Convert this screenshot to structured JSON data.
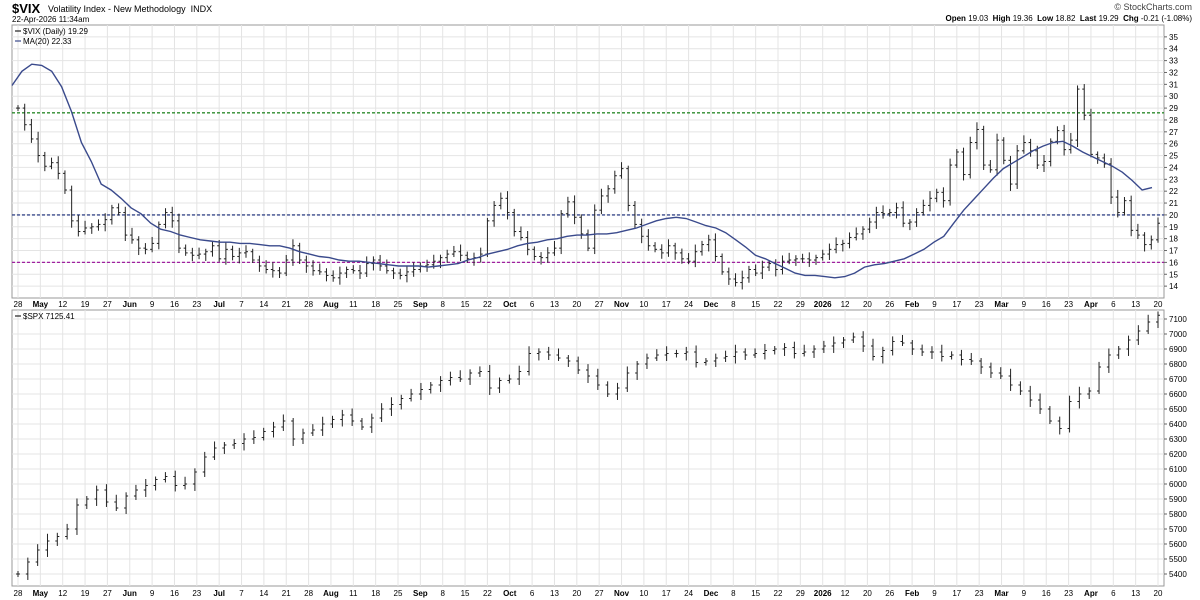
{
  "header": {
    "ticker": "$VIX",
    "name": "Volatility Index - New Methodology",
    "exchange": "INDX",
    "datetime": "22-Apr-2026 11:34am",
    "brand": "© StockCharts.com",
    "quote": {
      "open_label": "Open",
      "open": "19.03",
      "high_label": "High",
      "high": "19.36",
      "low_label": "Low",
      "low": "18.82",
      "last_label": "Last",
      "last": "19.29",
      "chg_label": "Chg",
      "chg": "-0.21 (-1.08%)"
    }
  },
  "colors": {
    "bars": "#222222",
    "ma": "#3a4a8c",
    "upper_line": "#2e8b2e",
    "mid_line": "#3a4a8c",
    "lower_line": "#a020a0",
    "grid": "#e4e4e4",
    "border": "#999999"
  },
  "chart_data": [
    {
      "type": "line",
      "subtype": "ohlc",
      "legend": [
        "$VIX (Daily) 19.29",
        "MA(20) 22.33"
      ],
      "series": [
        {
          "name": "$VIX (Daily)",
          "values": [
            29,
            27.6,
            26.4,
            25,
            24.1,
            24.4,
            23.5,
            22.1,
            19.5,
            18.6,
            18.9,
            19,
            19.2,
            19.6,
            20.6,
            20.2,
            18.3,
            17.9,
            17.2,
            17.1,
            17.6,
            19.2,
            20.2,
            19.5,
            17.2,
            16.8,
            16.6,
            16.7,
            16.9,
            17.4,
            16.3,
            17.1,
            16.5,
            16.8,
            16.9,
            16.2,
            15.7,
            15.4,
            15.3,
            15.1,
            16.2,
            17.4,
            16.2,
            15.7,
            15.3,
            15.2,
            14.9,
            14.7,
            15.1,
            15.4,
            15.3,
            15.1,
            15.9,
            16.2,
            15.7,
            15.3,
            15.1,
            14.9,
            15.2,
            15.4,
            15.7,
            15.8,
            16.1,
            16.4,
            16.7,
            16.9,
            16.6,
            16.3,
            16.4,
            16.7,
            19.5,
            20.8,
            21.4,
            20.2,
            18.6,
            18.1,
            17.1,
            16.5,
            16.4,
            16.8,
            17.2,
            20.1,
            21.1,
            19.8,
            18.4,
            17.2,
            20.4,
            21.6,
            22.2,
            23.3,
            23.9,
            20.8,
            19.2,
            18.2,
            17.4,
            17.1,
            16.8,
            17.4,
            16.8,
            16.3,
            16.1,
            16.9,
            17.5,
            17.9,
            16.5,
            15.2,
            14.6,
            14.3,
            14.7,
            15.4,
            15.1,
            15.6,
            15.9,
            15.4,
            16.1,
            16.2,
            16.3,
            16.3,
            16.2,
            16.4,
            16.7,
            17.1,
            17.5,
            17.6,
            18.1,
            18.4,
            18.8,
            19.4,
            20.2,
            20.1,
            20.2,
            20.6,
            19.3,
            19.4,
            20.2,
            20.8,
            21.4,
            21.9,
            21.2,
            24.2,
            25.3,
            23.4,
            26.1,
            27.2,
            24.2,
            23.8,
            26.3,
            24.6,
            22.6,
            25.4,
            26.1,
            25.4,
            24.2,
            24.5,
            26.2,
            27.1,
            25.5,
            26.3,
            30.6,
            28.4,
            25.1,
            24.8,
            24.3,
            21.5,
            20.2,
            21.2,
            18.7,
            18.3,
            17.5,
            17.9,
            19.3
          ]
        },
        {
          "name": "MA(20)",
          "values": [
            30.9,
            32.1,
            32.7,
            32.6,
            32.1,
            30.8,
            28.7,
            26.1,
            24.5,
            22.6,
            22.1,
            21.4,
            20.6,
            20.1,
            19.3,
            18.8,
            18.6,
            18.3,
            18.1,
            17.9,
            17.8,
            17.7,
            17.7,
            17.6,
            17.6,
            17.5,
            17.4,
            17.4,
            17.2,
            16.9,
            16.7,
            16.5,
            16.4,
            16.2,
            16.1,
            16.1,
            16,
            15.9,
            15.8,
            15.7,
            15.7,
            15.7,
            15.6,
            15.7,
            15.8,
            15.9,
            16.2,
            16.4,
            16.7,
            16.9,
            17.1,
            17.4,
            17.6,
            17.7,
            17.9,
            18,
            18.2,
            18.3,
            18.3,
            18.4,
            18.4,
            18.5,
            18.7,
            18.9,
            19.2,
            19.5,
            19.7,
            19.8,
            19.7,
            19.4,
            19.1,
            18.9,
            18.5,
            17.9,
            17.3,
            16.6,
            16.3,
            15.9,
            15.5,
            15.1,
            14.9,
            14.9,
            14.8,
            14.7,
            14.8,
            15.1,
            15.6,
            15.8,
            15.9,
            16.1,
            16.3,
            16.7,
            17.1,
            17.7,
            18.2,
            19.3,
            20.4,
            21.3,
            22.2,
            23.1,
            23.9,
            24.4,
            24.9,
            25.4,
            25.8,
            26.1,
            26.2,
            25.8,
            25.3,
            24.9,
            24.5,
            24.1,
            23.6,
            22.9,
            22.1,
            22.3
          ]
        }
      ],
      "y_ticks": [
        "14",
        "15",
        "16",
        "17",
        "18",
        "19",
        "20",
        "21",
        "22",
        "23",
        "24",
        "25",
        "26",
        "27",
        "28",
        "29",
        "30",
        "31",
        "32",
        "33",
        "34",
        "35"
      ],
      "ylim": [
        13,
        36
      ],
      "horizontal_lines": [
        {
          "value": 28.6,
          "color": "green",
          "style": "dashed"
        },
        {
          "value": 20,
          "color": "navy",
          "style": "dashed"
        },
        {
          "value": 16,
          "color": "purple",
          "style": "dashed"
        }
      ],
      "grid": true
    },
    {
      "type": "line",
      "subtype": "ohlc",
      "legend": [
        "$SPX 7125.41"
      ],
      "series": [
        {
          "name": "$SPX",
          "values": [
            5400,
            5480,
            5560,
            5620,
            5650,
            5700,
            5860,
            5900,
            5960,
            5880,
            5840,
            5920,
            5960,
            5990,
            6030,
            6050,
            5990,
            6000,
            6080,
            6180,
            6240,
            6260,
            6270,
            6300,
            6310,
            6350,
            6380,
            6420,
            6300,
            6340,
            6360,
            6400,
            6430,
            6460,
            6420,
            6380,
            6440,
            6500,
            6530,
            6570,
            6600,
            6630,
            6660,
            6690,
            6710,
            6700,
            6740,
            6750,
            6640,
            6690,
            6700,
            6750,
            6870,
            6880,
            6860,
            6840,
            6820,
            6760,
            6720,
            6660,
            6600,
            6640,
            6740,
            6800,
            6840,
            6860,
            6870,
            6870,
            6880,
            6810,
            6820,
            6840,
            6850,
            6880,
            6860,
            6870,
            6890,
            6900,
            6910,
            6870,
            6880,
            6900,
            6920,
            6940,
            6960,
            6980,
            6920,
            6850,
            6890,
            6950,
            6940,
            6900,
            6880,
            6880,
            6850,
            6860,
            6830,
            6820,
            6780,
            6740,
            6720,
            6660,
            6620,
            6560,
            6500,
            6420,
            6370,
            6550,
            6600,
            6620,
            6780,
            6860,
            6900,
            6960,
            7020,
            7080,
            7125
          ]
        }
      ],
      "y_ticks": [
        "5400",
        "5500",
        "5600",
        "5700",
        "5800",
        "5900",
        "6000",
        "6100",
        "6200",
        "6300",
        "6400",
        "6500",
        "6600",
        "6700",
        "6800",
        "6900",
        "7000",
        "7100"
      ],
      "ylim": [
        5320,
        7160
      ],
      "grid": true
    }
  ],
  "x_axis": {
    "ticks_top": [
      "28",
      "May",
      "12",
      "19",
      "27",
      "Jun",
      "9",
      "16",
      "23",
      "Jul",
      "7",
      "14",
      "21",
      "28",
      "Aug",
      "11",
      "18",
      "25",
      "Sep",
      "8",
      "15",
      "22",
      "Oct",
      "6",
      "13",
      "20",
      "27",
      "Nov",
      "10",
      "17",
      "24",
      "Dec",
      "8",
      "15",
      "22",
      "29",
      "2026",
      "12",
      "20",
      "26",
      "Feb",
      "9",
      "17",
      "23",
      "Mar",
      "9",
      "16",
      "23",
      "Apr",
      "6",
      "13",
      "20"
    ],
    "ticks_bottom": [
      "28",
      "May",
      "12",
      "19",
      "27",
      "Jun",
      "9",
      "16",
      "23",
      "Jul",
      "7",
      "14",
      "21",
      "28",
      "Aug",
      "11",
      "18",
      "25",
      "Sep",
      "8",
      "15",
      "22",
      "Oct",
      "6",
      "13",
      "20",
      "27",
      "Nov",
      "10",
      "17",
      "24",
      "Dec",
      "8",
      "15",
      "22",
      "29",
      "2026",
      "12",
      "20",
      "26",
      "Feb",
      "9",
      "17",
      "23",
      "Mar",
      "9",
      "16",
      "23",
      "Apr",
      "6",
      "13",
      "20"
    ]
  }
}
